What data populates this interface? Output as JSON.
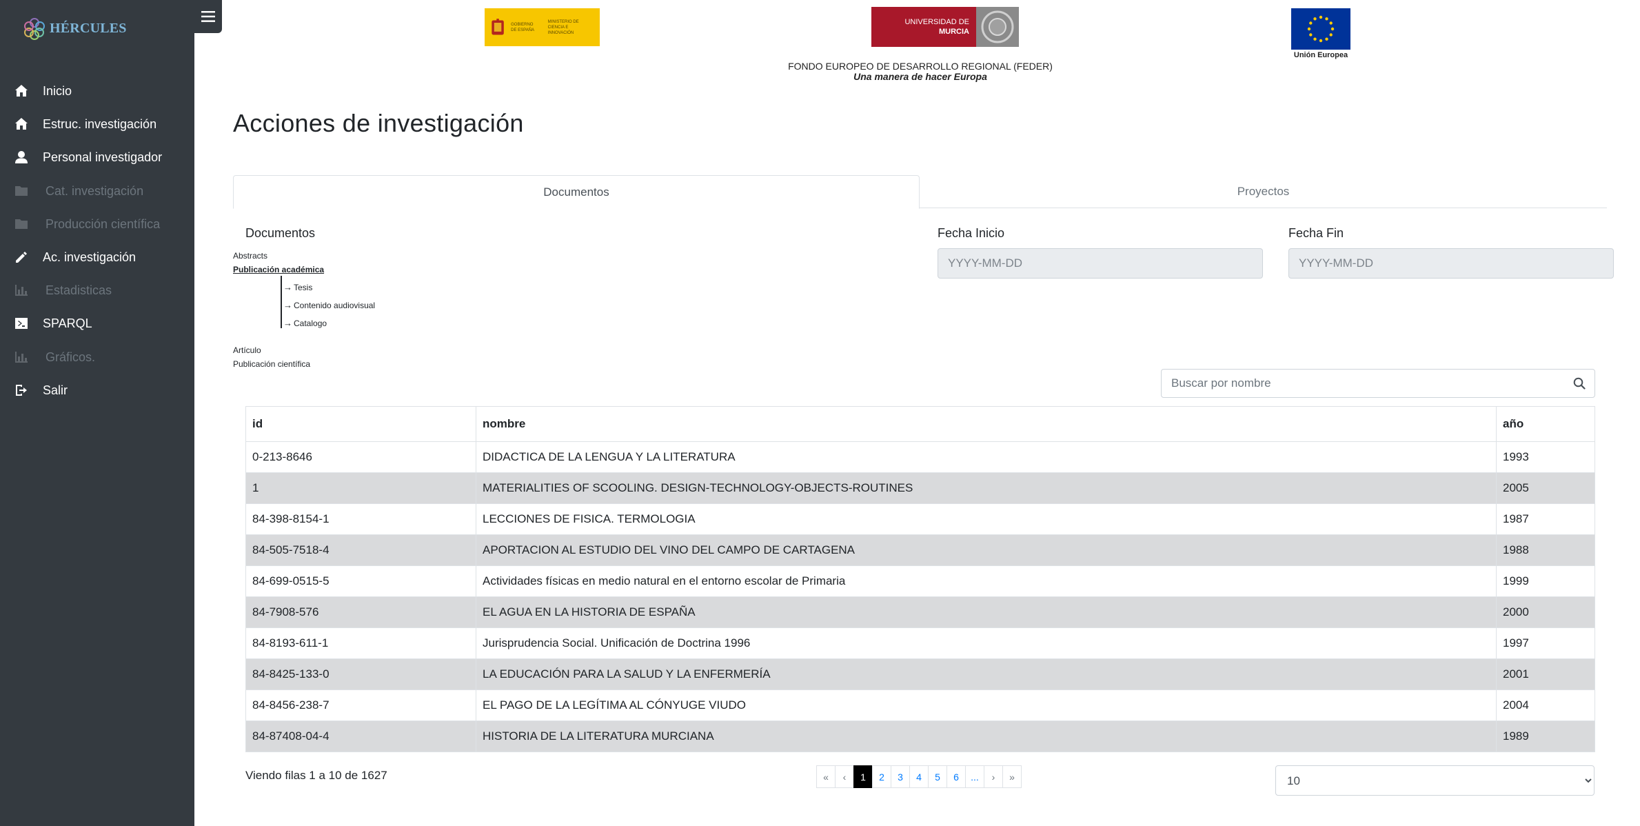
{
  "app": {
    "brand": "HÉRCULES"
  },
  "sidebar": {
    "items": [
      {
        "label": "Inicio",
        "icon": "home-icon",
        "enabled": true
      },
      {
        "label": "Estruc. investigación",
        "icon": "home-icon",
        "enabled": true
      },
      {
        "label": "Personal investigador",
        "icon": "user-icon",
        "enabled": true
      },
      {
        "label": "Cat. investigación",
        "icon": "folder-icon",
        "enabled": false
      },
      {
        "label": "Producción científica",
        "icon": "folder-icon",
        "enabled": false
      },
      {
        "label": "Ac. investigación",
        "icon": "pencil-icon",
        "enabled": true
      },
      {
        "label": "Estadisticas",
        "icon": "bar-chart-icon",
        "enabled": false
      },
      {
        "label": "SPARQL",
        "icon": "terminal-icon",
        "enabled": true
      },
      {
        "label": "Gráficos.",
        "icon": "bar-chart-icon",
        "enabled": false
      },
      {
        "label": "Salir",
        "icon": "logout-icon",
        "enabled": true
      }
    ]
  },
  "header": {
    "gob_line1": "GOBIERNO DE ESPAÑA",
    "gob_line2": "MINISTERIO DE CIENCIA E INNOVACIÓN",
    "um_line1": "UNIVERSIDAD DE",
    "um_line2": "MURCIA",
    "eu_label": "Unión Europea",
    "feder_line1": "FONDO EUROPEO DE DESARROLLO REGIONAL (FEDER)",
    "feder_line2": "Una manera de hacer Europa"
  },
  "page": {
    "title": "Acciones de investigación"
  },
  "tabs": [
    {
      "label": "Documentos",
      "active": true
    },
    {
      "label": "Proyectos",
      "active": false
    }
  ],
  "tree": {
    "title": "Documentos",
    "items": [
      "Abstracts",
      "Publicación académica"
    ],
    "selected": "Publicación académica",
    "children": [
      "Tesis",
      "Contenido audiovisual",
      "Catalogo"
    ],
    "items_after": [
      "Artículo",
      "Publicación científica"
    ]
  },
  "filters": {
    "start_label": "Fecha Inicio",
    "start_placeholder": "YYYY-MM-DD",
    "end_label": "Fecha Fin",
    "end_placeholder": "YYYY-MM-DD"
  },
  "search": {
    "placeholder": "Buscar por nombre",
    "icon": "search-icon"
  },
  "table": {
    "columns": [
      "id",
      "nombre",
      "año"
    ],
    "rows": [
      [
        "0-213-8646",
        "DIDACTICA DE LA LENGUA Y LA LITERATURA",
        "1993"
      ],
      [
        "1",
        "MATERIALITIES OF SCOOLING. DESIGN-TECHNOLOGY-OBJECTS-ROUTINES",
        "2005"
      ],
      [
        "84-398-8154-1",
        "LECCIONES DE FISICA. TERMOLOGIA",
        "1987"
      ],
      [
        "84-505-7518-4",
        "APORTACION AL ESTUDIO DEL VINO DEL CAMPO DE CARTAGENA",
        "1988"
      ],
      [
        "84-699-0515-5",
        "Actividades físicas en medio natural en el entorno escolar de Primaria",
        "1999"
      ],
      [
        "84-7908-576",
        "EL AGUA EN LA HISTORIA DE ESPAÑA",
        "2000"
      ],
      [
        "84-8193-611-1",
        "Jurisprudencia Social. Unificación de Doctrina 1996",
        "1997"
      ],
      [
        "84-8425-133-0",
        "LA EDUCACIÓN PARA LA SALUD Y LA ENFERMERÍA",
        "2001"
      ],
      [
        "84-8456-238-7",
        "EL PAGO DE LA LEGÍTIMA AL CÓNYUGE VIUDO",
        "2004"
      ],
      [
        "84-87408-04-4",
        "HISTORIA DE LA LITERATURA MURCIANA",
        "1989"
      ]
    ]
  },
  "footer": {
    "rows_info": "Viendo filas 1 a 10 de 1627",
    "pages": [
      "«",
      "‹",
      "1",
      "2",
      "3",
      "4",
      "5",
      "6",
      "...",
      "›",
      "»"
    ],
    "current_page": "1",
    "page_size": "10"
  },
  "colors": {
    "sidebar": "#343a40",
    "active_page": "#000000",
    "link": "#007bff"
  }
}
